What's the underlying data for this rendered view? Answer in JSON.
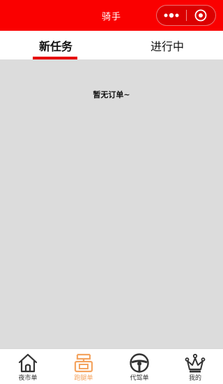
{
  "nav": {
    "title": "骑手"
  },
  "tabs": [
    {
      "label": "新任务",
      "active": true
    },
    {
      "label": "进行中",
      "active": false
    }
  ],
  "empty_message": "暂无订单~",
  "tabbar": {
    "items": [
      {
        "label": "夜市单",
        "icon": "home-icon",
        "active": false
      },
      {
        "label": "跑腿单",
        "icon": "errand-icon",
        "active": true
      },
      {
        "label": "代驾单",
        "icon": "steering-wheel-icon",
        "active": false
      },
      {
        "label": "我的",
        "icon": "crown-icon",
        "active": false
      }
    ]
  },
  "colors": {
    "nav_bg": "#fa0000",
    "accent": "#e60000",
    "active_tab_icon": "#f4a460",
    "page_bg": "#dcdcdc"
  }
}
